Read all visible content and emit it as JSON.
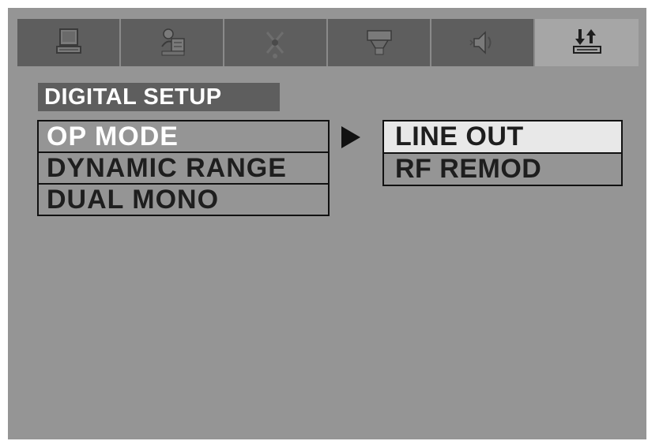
{
  "tabs": [
    {
      "icon": "monitor-icon",
      "active": false
    },
    {
      "icon": "language-settings-icon",
      "active": false
    },
    {
      "icon": "audio-icon",
      "active": false
    },
    {
      "icon": "video-icon",
      "active": false
    },
    {
      "icon": "speaker-icon",
      "active": false
    },
    {
      "icon": "digital-setup-icon",
      "active": true
    }
  ],
  "section": {
    "title": "DIGITAL SETUP"
  },
  "menu": {
    "items": [
      {
        "label": "OP MODE",
        "selected": true
      },
      {
        "label": "DYNAMIC RANGE",
        "selected": false
      },
      {
        "label": "DUAL MONO",
        "selected": false
      }
    ]
  },
  "submenu": {
    "items": [
      {
        "label": "LINE OUT",
        "highlighted": true
      },
      {
        "label": "RF REMOD",
        "highlighted": false
      }
    ]
  },
  "colors": {
    "background": "#959595",
    "tab_inactive": "#5e5e5e",
    "tab_active": "#a6a6a6",
    "title_bar": "#5e5e5e",
    "highlight": "#e8e8e8",
    "border": "#111111"
  }
}
